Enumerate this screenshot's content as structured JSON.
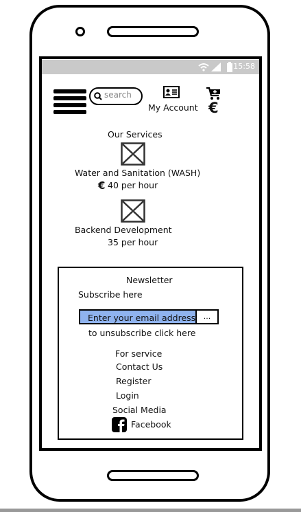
{
  "status_bar": {
    "time": "15:58"
  },
  "header": {
    "search_placeholder": "search",
    "account_label": "My Account",
    "currency_symbol": "€"
  },
  "services": {
    "title": "Our Services",
    "items": [
      {
        "name": "Water and Sanitation (WASH)",
        "price": "40 per hour",
        "currency": "€"
      },
      {
        "name": "Backend Development",
        "price": "35 per hour"
      }
    ]
  },
  "newsletter": {
    "title": "Newsletter",
    "subscribe_label": "Subscribe here",
    "email_placeholder": "Enter your email address",
    "submit_label": "...",
    "unsubscribe_text": "to unsubscribe click here"
  },
  "footer_links": {
    "for_service": "For service",
    "contact": "Contact Us",
    "register": "Register",
    "login": "Login",
    "social_media": "Social Media",
    "facebook": "Facebook"
  }
}
